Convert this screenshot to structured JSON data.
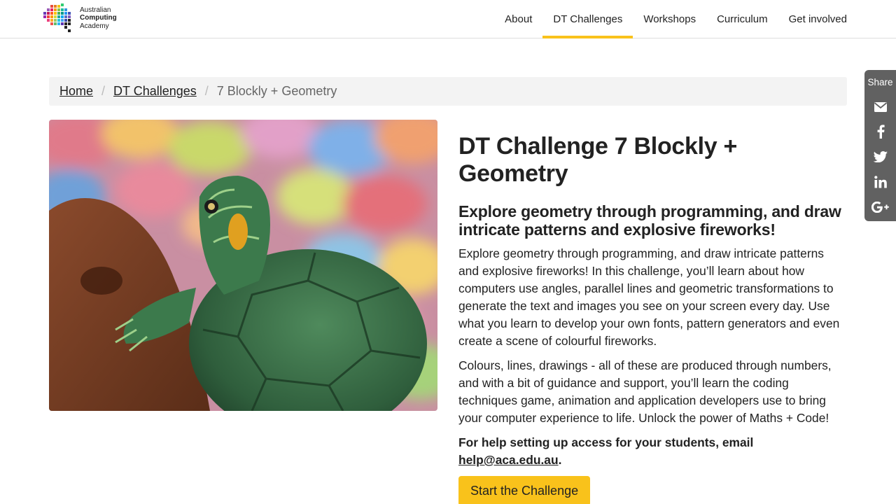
{
  "logo": {
    "line1": "Australian",
    "line2": "Computing",
    "line3": "Academy"
  },
  "nav": {
    "items": [
      {
        "label": "About"
      },
      {
        "label": "DT Challenges"
      },
      {
        "label": "Workshops"
      },
      {
        "label": "Curriculum"
      },
      {
        "label": "Get involved"
      }
    ],
    "active": "DT Challenges",
    "accent_color": "#f9c21b"
  },
  "breadcrumb": {
    "home": "Home",
    "section": "DT Challenges",
    "current": "7 Blockly + Geometry",
    "separator": "/"
  },
  "main": {
    "title": "DT Challenge 7 Blockly + Geometry",
    "subtitle": "Explore geometry through programming, and draw intricate patterns and explosive fireworks!",
    "paragraph1": "Explore geometry through programming, and draw intricate patterns and explosive fireworks! In this challenge, you’ll learn about how computers use angles, parallel lines and geometric transformations to generate the text and images you see on your screen every day. Use what you learn to develop your own fonts, pattern generators and even create a scene of colourful fireworks.",
    "paragraph2": "Colours, lines, drawings - all of these are produced through numbers, and with a bit of guidance and support, you’ll learn the coding techniques game, animation and application developers use to bring your computer experience to life. Unlock the power of Maths + Code!",
    "help_text": "For help setting up access for your students, email ",
    "help_email": "help@aca.edu.au",
    "help_end": ".",
    "cta_label": "Start the Challenge"
  },
  "share": {
    "label": "Share",
    "buttons": [
      "envelope-icon",
      "facebook-icon",
      "twitter-icon",
      "linkedin-icon",
      "google-plus-icon"
    ],
    "background_color": "#616161"
  },
  "hero_image": {
    "subject": "turtle-photo"
  }
}
